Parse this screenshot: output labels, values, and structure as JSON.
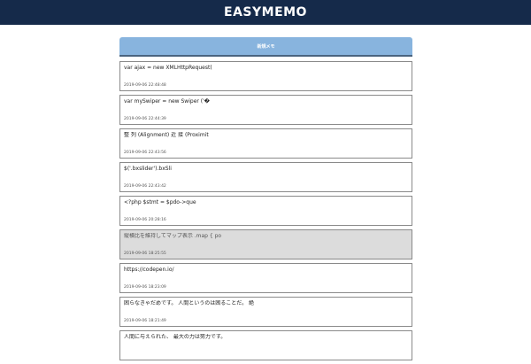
{
  "app": {
    "title": "EASYMEMO"
  },
  "toolbar": {
    "new_memo_label": "新規メモ"
  },
  "memos": [
    {
      "text": "var ajax = new XMLHttpRequest(",
      "date": "2019-09-06 22:48:48",
      "selected": false
    },
    {
      "text": "var mySwiper = new Swiper ('�",
      "date": "2019-09-06 22:44:39",
      "selected": false
    },
    {
      "text": "整 列 (Alignment) 近 接 (Proximit",
      "date": "2019-09-06 22:43:56",
      "selected": false
    },
    {
      "text": "$('.bxslider').bxSli",
      "date": "2019-09-06 22:43:42",
      "selected": false
    },
    {
      "text": "<?php $stmt = $pdo->que",
      "date": "2019-09-06 20:28:16",
      "selected": false
    },
    {
      "text": "縦横比を維持してマップ表示 .map { po",
      "date": "2019-09-06 18:25:55",
      "selected": true
    },
    {
      "text": "https://codepen.io/",
      "date": "2019-09-06 18:23:09",
      "selected": false
    },
    {
      "text": "困らなきゃだめです。 人間というのは困ることだ。 絶",
      "date": "2019-09-06 18:21:49",
      "selected": false
    },
    {
      "text": "人間に与えられた、 最大の力は努力です。",
      "date": "",
      "selected": false
    }
  ]
}
